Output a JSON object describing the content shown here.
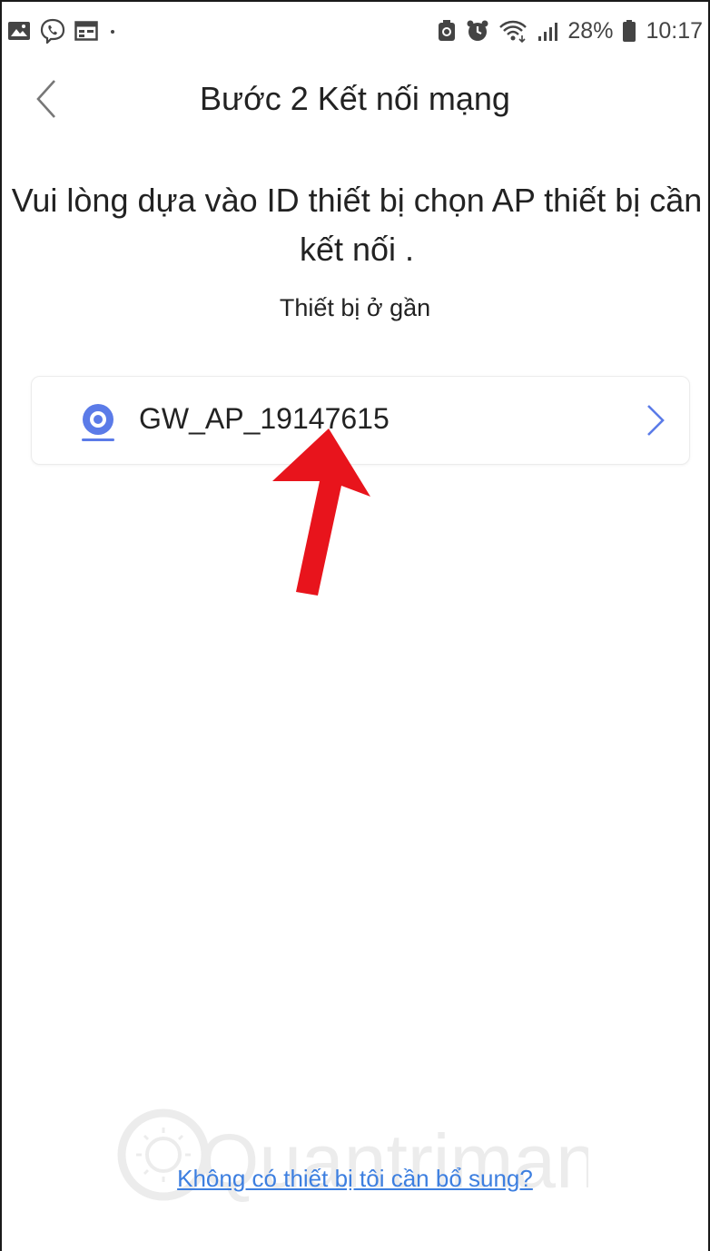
{
  "status_bar": {
    "left_icons": [
      "gallery-icon",
      "viber-icon",
      "calendar-icon",
      "dot-icon"
    ],
    "right_icons": [
      "battery-saver-icon",
      "alarm-icon",
      "wifi-icon",
      "signal-icon",
      "battery-icon"
    ],
    "battery": "28%",
    "time": "10:17"
  },
  "header": {
    "back_icon": "chevron-left-icon",
    "title": "Bước 2 Kết nối mạng"
  },
  "instruction": "Vui lòng dựa vào ID thiết bị chọn AP thiết bị cần kết nối .",
  "nearby": {
    "label": "Thiết bị ở gần",
    "devices": [
      {
        "icon": "camera-icon",
        "name": "GW_AP_19147615"
      }
    ]
  },
  "footer": {
    "link": "Không có thiết bị tôi cần bổ sung?"
  },
  "watermark": "Quantrimang",
  "colors": {
    "accent": "#3d7fe0",
    "device_icon": "#5b7be8",
    "annotation_arrow": "#e8141c",
    "text": "#222222"
  }
}
